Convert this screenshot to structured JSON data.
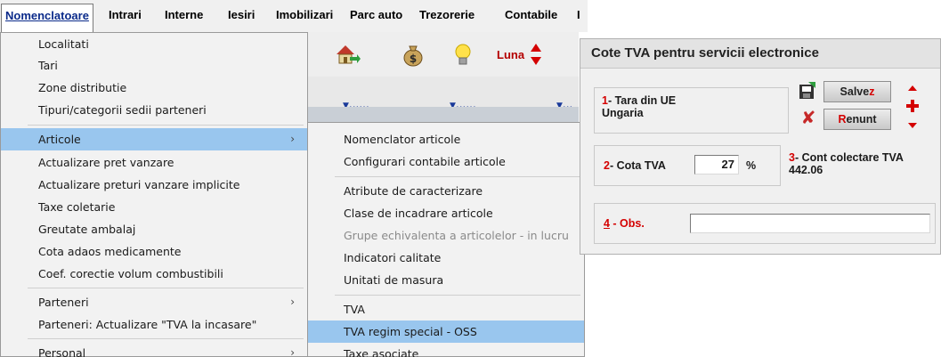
{
  "menubar": {
    "items": [
      {
        "label": "Nomenclatoare",
        "active": true
      },
      {
        "label": "Intrari"
      },
      {
        "label": "Interne"
      },
      {
        "label": "Iesiri"
      },
      {
        "label": "Imobilizari"
      },
      {
        "label": "Parc auto"
      },
      {
        "label": "Trezorerie"
      },
      {
        "label": "Contabile"
      },
      {
        "label": "I"
      }
    ]
  },
  "background_app": {
    "luna_label": "Luna",
    "dots": [
      "......",
      "......",
      "..."
    ],
    "icons": [
      "house-arrow-icon",
      "money-bag-icon",
      "lightbulb-icon",
      "up-down-arrows-icon"
    ]
  },
  "menu": {
    "items": [
      {
        "label": "Localitati"
      },
      {
        "label": "Tari"
      },
      {
        "label": "Zone distributie"
      },
      {
        "label": "Tipuri/categorii sedii parteneri"
      },
      {
        "label": "Articole",
        "arrow": "›",
        "highlighted": true
      },
      {
        "label": "Actualizare pret vanzare"
      },
      {
        "label": "Actualizare preturi vanzare implicite"
      },
      {
        "label": "Taxe coletarie"
      },
      {
        "label": "Greutate ambalaj"
      },
      {
        "label": "Cota adaos medicamente"
      },
      {
        "label": "Coef. corectie volum combustibili"
      },
      {
        "label": "Parteneri",
        "arrow": "›"
      },
      {
        "label": "Parteneri: Actualizare \"TVA la incasare\""
      },
      {
        "label": "Personal",
        "arrow": "›"
      }
    ]
  },
  "submenu": {
    "items": [
      {
        "label": "Nomenclator articole"
      },
      {
        "label": "Configurari contabile articole"
      },
      {
        "label": "Atribute de caracterizare"
      },
      {
        "label": "Clase de incadrare articole"
      },
      {
        "label": "Grupe echivalenta a articolelor - in lucru",
        "disabled": true
      },
      {
        "label": "Indicatori calitate"
      },
      {
        "label": "Unitati de masura"
      },
      {
        "label": "TVA"
      },
      {
        "label": "TVA regim special - OSS",
        "highlighted": true
      },
      {
        "label": "Taxe asociate"
      }
    ]
  },
  "dialog": {
    "title": "Cote TVA pentru servicii electronice",
    "tara": {
      "num": "1",
      "label": "- Tara din UE",
      "value": "Ungaria"
    },
    "save_button": {
      "text": "Salve",
      "hotkey": "z"
    },
    "cancel_button": {
      "hotkey": "R",
      "text": "enunt"
    },
    "cota": {
      "num": "2",
      "label": "- Cota TVA",
      "value": "27",
      "unit": "%"
    },
    "cont": {
      "num": "3",
      "label": "- Cont colectare TVA",
      "value": "442.06"
    },
    "obs": {
      "num": "4",
      "label": " - Obs.",
      "value": ""
    },
    "colors": {
      "accent_red": "#d40000",
      "highlight_blue": "#99c6ee"
    }
  }
}
